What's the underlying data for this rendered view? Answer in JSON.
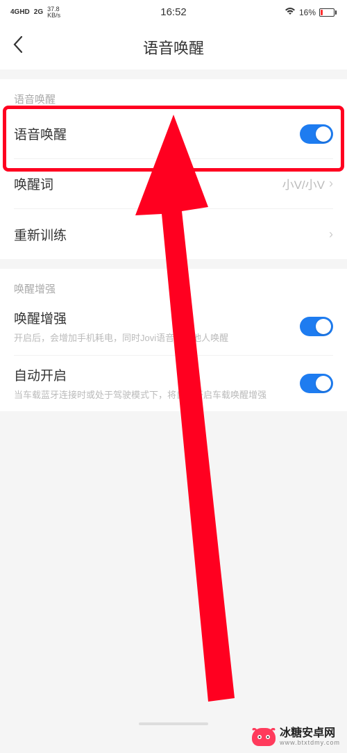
{
  "status": {
    "signal1": "4GHD",
    "signal2": "2G",
    "speed_top": "37.8",
    "speed_unit": "KB/s",
    "time": "16:52",
    "battery_pct": "16%"
  },
  "header": {
    "title": "语音唤醒"
  },
  "section1": {
    "label": "语音唤醒",
    "voice_wake": {
      "title": "语音唤醒",
      "on": true
    },
    "wake_word": {
      "title": "唤醒词",
      "value": "小V/小V"
    },
    "retrain": {
      "title": "重新训练"
    }
  },
  "section2": {
    "label": "唤醒增强",
    "enhance": {
      "title": "唤醒增强",
      "desc": "开启后，会增加手机耗电，同时Jovi语音可被他人唤醒",
      "on": true
    },
    "auto_on": {
      "title": "自动开启",
      "desc": "当车载蓝牙连接时或处于驾驶模式下，将自动开启车载唤醒增强",
      "on": true
    }
  },
  "watermark": {
    "cn": "冰糖安卓网",
    "en": "www.btxtdmy.com"
  }
}
